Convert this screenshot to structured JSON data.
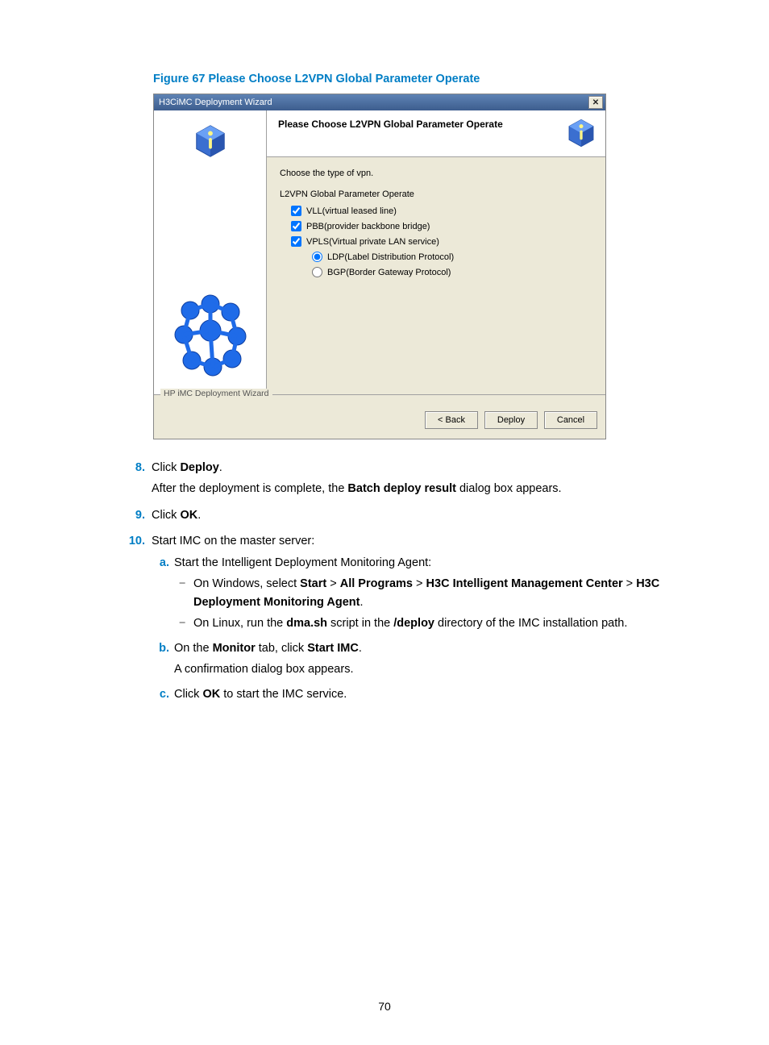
{
  "figure_caption": "Figure 67 Please Choose L2VPN Global Parameter Operate",
  "dialog": {
    "title": "H3CiMC Deployment Wizard",
    "close_label": "✕",
    "header_title": "Please Choose L2VPN Global Parameter Operate",
    "choose_text": "Choose the type of vpn.",
    "group_label": "L2VPN Global Parameter Operate",
    "options": {
      "vll": "VLL(virtual leased line)",
      "pbb": "PBB(provider backbone bridge)",
      "vpls": "VPLS(Virtual private LAN service)",
      "ldp": "LDP(Label Distribution Protocol)",
      "bgp": "BGP(Border Gateway Protocol)"
    },
    "footer_legend": "HP iMC Deployment Wizard",
    "buttons": {
      "back": "< Back",
      "deploy": "Deploy",
      "cancel": "Cancel"
    }
  },
  "steps": {
    "s8_num": "8.",
    "s8_text_pre": "Click ",
    "s8_text_bold": "Deploy",
    "s8_text_post": ".",
    "s8_p2_pre": "After the deployment is complete, the ",
    "s8_p2_bold": "Batch deploy result",
    "s8_p2_post": " dialog box appears.",
    "s9_num": "9.",
    "s9_text_pre": "Click ",
    "s9_text_bold": "OK",
    "s9_text_post": ".",
    "s10_num": "10.",
    "s10_text": "Start IMC on the master server:",
    "s10a_letter": "a.",
    "s10a_text": "Start the Intelligent Deployment Monitoring Agent:",
    "s10a_d1_pre": "On Windows, select ",
    "s10a_d1_b1": "Start",
    "s10a_d1_gt1": " > ",
    "s10a_d1_b2": "All Programs",
    "s10a_d1_gt2": " > ",
    "s10a_d1_b3": "H3C Intelligent Management Center",
    "s10a_d1_gt3": " > ",
    "s10a_d1_b4": "H3C Deployment Monitoring Agent",
    "s10a_d1_post": ".",
    "s10a_d2_pre": "On Linux, run the ",
    "s10a_d2_b1": "dma.sh",
    "s10a_d2_mid": " script in the ",
    "s10a_d2_b2": "/deploy",
    "s10a_d2_post": " directory of the IMC installation path.",
    "s10b_letter": "b.",
    "s10b_pre": "On the ",
    "s10b_b1": "Monitor",
    "s10b_mid": " tab, click ",
    "s10b_b2": "Start IMC",
    "s10b_post": ".",
    "s10b_p2": "A confirmation dialog box appears.",
    "s10c_letter": "c.",
    "s10c_pre": "Click ",
    "s10c_b1": "OK",
    "s10c_post": " to start the IMC service."
  },
  "page_number": "70"
}
